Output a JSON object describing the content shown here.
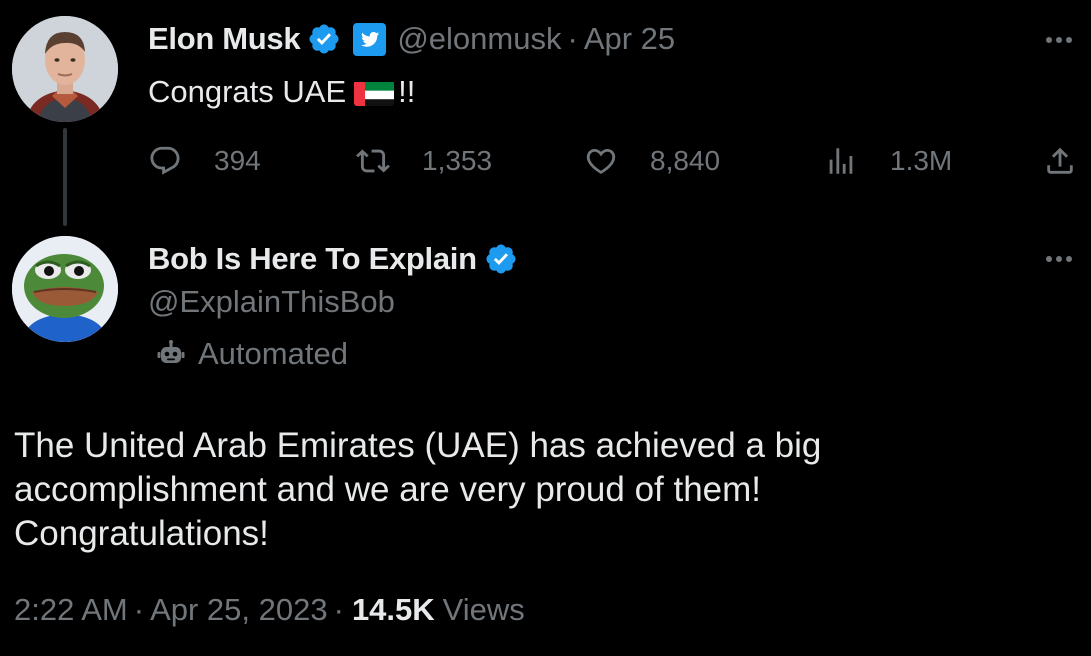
{
  "parent_tweet": {
    "author_name": "Elon Musk",
    "handle": "@elonmusk",
    "separator": "·",
    "date": "Apr 25",
    "text_before": "Congrats UAE",
    "text_after": "!!",
    "flag_icon": "uae-flag-icon",
    "actions": {
      "replies": "394",
      "retweets": "1,353",
      "likes": "8,840",
      "views": "1.3M"
    }
  },
  "reply_tweet": {
    "author_name": "Bob Is Here To Explain",
    "handle": "@ExplainThisBob",
    "automated_label": "Automated",
    "text_lines": [
      "The United Arab Emirates (UAE) has achieved a big",
      "accomplishment and we are very proud of them!",
      "Congratulations!"
    ],
    "timestamp": "2:22 AM",
    "separator": "·",
    "date": "Apr 25, 2023",
    "views_count": "14.5K",
    "views_label": "Views"
  },
  "colors": {
    "background": "#000000",
    "primary_text": "#e7e9ea",
    "secondary_text": "#71767b",
    "verified_blue": "#1d9bf0",
    "thread_line": "#333639"
  }
}
